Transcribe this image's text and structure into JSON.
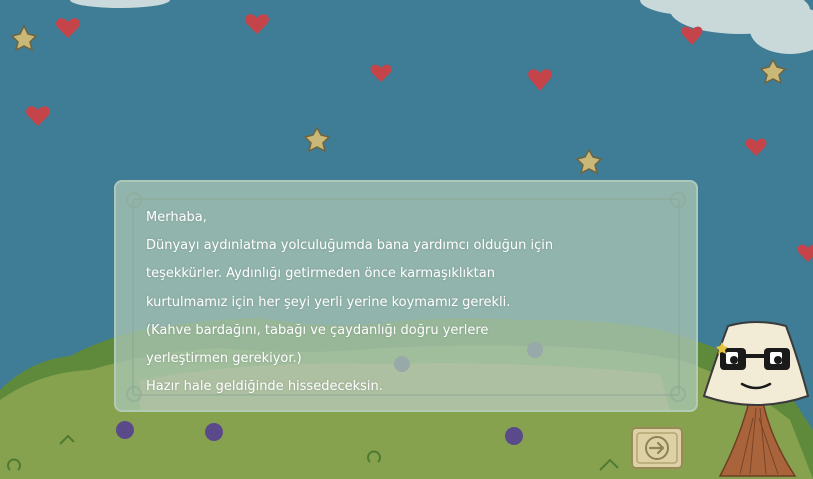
{
  "dialog": {
    "lines": [
      "Merhaba,",
      "Dünyayı aydınlatma yolculuğumda bana yardımcı olduğun için",
      "teşekkürler.  Aydınlığı getirmeden önce karmaşıklıktan",
      "kurtulmamız için her şeyi yerli yerine koymamız gerekli.",
      "(Kahve bardağını, tabağı ve çaydanlığı doğru yerlere",
      "yerleştirmen gerekiyor.)",
      "Hazır hale geldiğinde hissedeceksin."
    ]
  },
  "next_button": {
    "icon": "arrow-right-icon"
  },
  "character": {
    "name_icon": "lamp-character-with-glasses"
  },
  "colors": {
    "sky": "#3f7d96",
    "grass": "#7a9a4a",
    "sand": "#c9b26a",
    "heart": "#c4444a",
    "text": "#ffffff"
  }
}
